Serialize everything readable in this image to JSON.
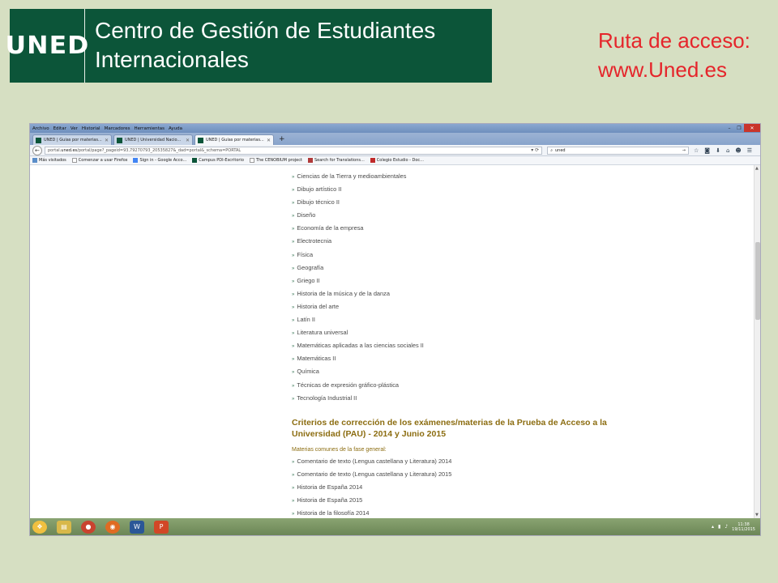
{
  "banner": {
    "logo": "UNED",
    "title_line1": "Centro de Gestión de Estudiantes",
    "title_line2": "Internacionales"
  },
  "access": {
    "line1": "Ruta de acceso:",
    "line2": "www.Uned.es"
  },
  "browser": {
    "menu": [
      "Archivo",
      "Editar",
      "Ver",
      "Historial",
      "Marcadores",
      "Herramientas",
      "Ayuda"
    ],
    "tabs": [
      {
        "label": "UNED | Guías por materias..."
      },
      {
        "label": "UNED | Universidad Nacio..."
      },
      {
        "label": "UNED | Guías por materias..."
      }
    ],
    "url_prefix": "portal",
    "url_domain": ".uned.es",
    "url_rest": "/portal/page?_pageid=93,79270793_20535827&_dad=portal&_schema=PORTAL",
    "search_value": "uned",
    "bookmarks": [
      "Más visitados",
      "Comenzar a usar Firefox",
      "Sign in - Google Acco...",
      "Campus PDI-Escritorio",
      "The CENOBIUM project",
      "Search for Translations...",
      "Colegio Estudio - Doc..."
    ]
  },
  "content": {
    "subjects": [
      "Ciencias de la Tierra y medioambientales",
      "Dibujo artístico II",
      "Dibujo técnico II",
      "Diseño",
      "Economía de la empresa",
      "Electrotecnia",
      "Física",
      "Geografía",
      "Griego II",
      "Historia de la música y de la danza",
      "Historia del arte",
      "Latín II",
      "Literatura universal",
      "Matemáticas aplicadas a las ciencias sociales II",
      "Matemáticas II",
      "Química",
      "Técnicas de expresión gráfico-plástica",
      "Tecnología Industrial II"
    ],
    "section_title": "Criterios de corrección de los exámenes/materias de la Prueba de Acceso a la Universidad (PAU) - 2014 y Junio 2015",
    "section_subhead": "Materias comunes de la fase general:",
    "common_subjects": [
      "Comentario de texto (Lengua castellana y Literatura) 2014",
      "Comentario de texto (Lengua castellana y Literatura) 2015",
      "Historia de España 2014",
      "Historia de España 2015",
      "Historia de la filosofía 2014"
    ]
  },
  "taskbar": {
    "time": "11:38",
    "date": "19/11/2015"
  }
}
